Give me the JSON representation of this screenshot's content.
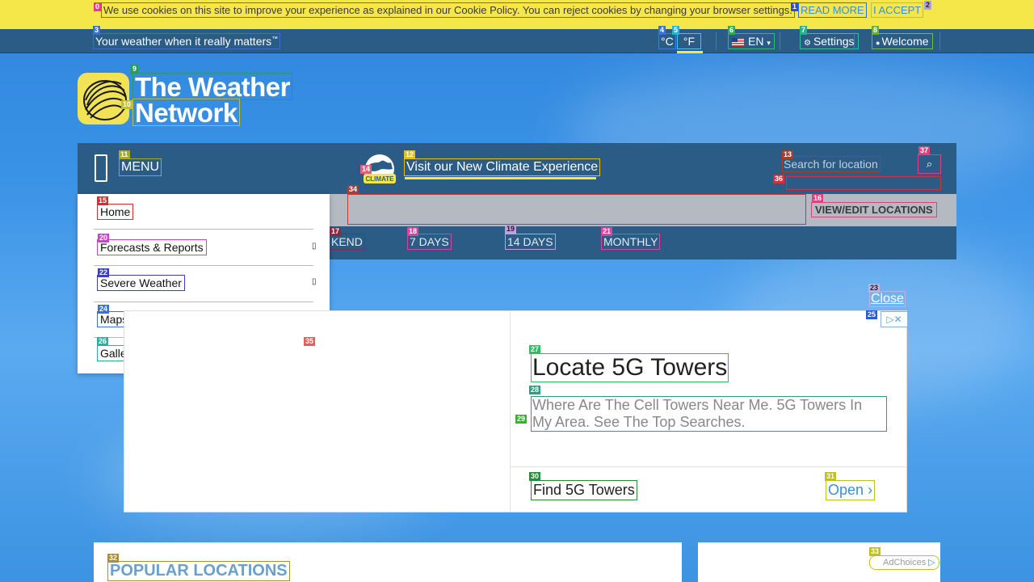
{
  "cookie_bar": {
    "text": "We use cookies on this site to improve your experience as explained in our Cookie Policy. You can reject cookies by changing your browser settings.",
    "read_more": "READ MORE",
    "accept": "I ACCEPT",
    "background": "#f5e64a"
  },
  "top_bar": {
    "tagline": "Your weather when it really matters",
    "tagline_mark": "™",
    "unit_c": "°C",
    "unit_f": "°F",
    "language": "EN",
    "settings": "Settings",
    "welcome": "Welcome",
    "background": "#2a5c85"
  },
  "logo": {
    "line1": "The Weather",
    "line2": "Network",
    "mark_color": "#f2e255"
  },
  "nav": {
    "menu_label": "MENU",
    "climate_badge": "CLIMATE",
    "climate_link": "Visit our New Climate Experience",
    "search_placeholder": "Search for location",
    "view_edit": "VIEW/EDIT LOCATIONS",
    "tabs": [
      {
        "label": "KEND"
      },
      {
        "label": "7 DAYS"
      },
      {
        "label": "14 DAYS"
      },
      {
        "label": "MONTHLY"
      }
    ]
  },
  "dropdown": {
    "items": [
      {
        "label": "Home",
        "has_submenu": false
      },
      {
        "label": "Forecasts & Reports",
        "has_submenu": true
      },
      {
        "label": "Severe Weather",
        "has_submenu": true
      },
      {
        "label": "Maps & Roads",
        "has_submenu": true
      },
      {
        "label": "Gallery",
        "has_submenu": true
      }
    ]
  },
  "ad": {
    "close_label": "Close",
    "title": "Locate 5G Towers",
    "description": "Where Are The Cell Towers Near Me. 5G Towers In My Area. See The Top Searches.",
    "cta": "Find 5G Towers",
    "open": "Open",
    "adchoices": "AdChoices"
  },
  "sections": {
    "popular_title": "POPULAR LOCATIONS"
  },
  "badges": [
    "0",
    "1",
    "2",
    "3",
    "4",
    "5",
    "6",
    "7",
    "8",
    "9",
    "10",
    "11",
    "12",
    "13",
    "14",
    "15",
    "16",
    "17",
    "18",
    "19",
    "20",
    "21",
    "22",
    "23",
    "24",
    "25",
    "26",
    "27",
    "28",
    "29",
    "30",
    "31",
    "32",
    "33",
    "34",
    "35",
    "36",
    "37"
  ]
}
